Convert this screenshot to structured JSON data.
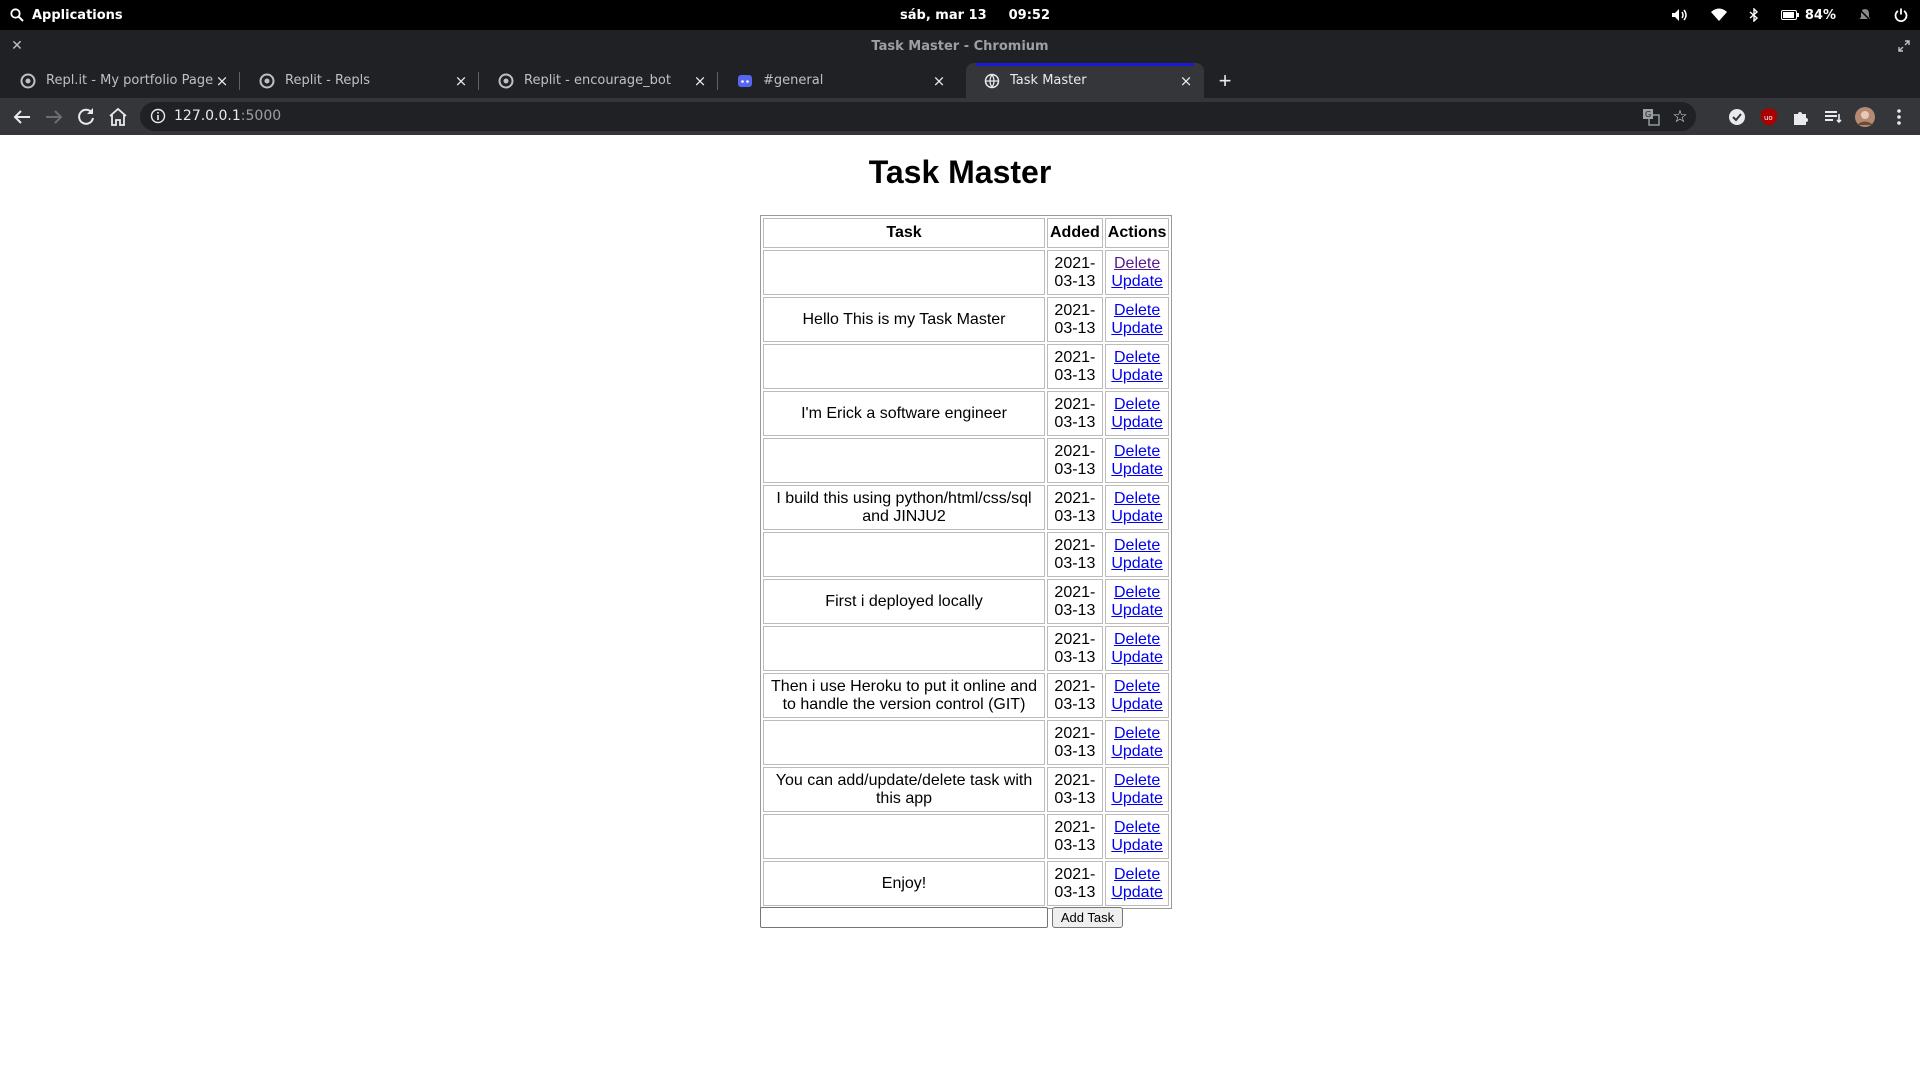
{
  "system_bar": {
    "applications_label": "Applications",
    "date": "sáb, mar 13",
    "time": "09:52",
    "battery_percent": "84%"
  },
  "window": {
    "title": "Task Master - Chromium"
  },
  "tabs": [
    {
      "label": "Repl.it - My portfolio Page",
      "favicon": "replit-icon",
      "active": false
    },
    {
      "label": "Replit - Repls",
      "favicon": "replit-icon",
      "active": false
    },
    {
      "label": "Replit - encourage_bot",
      "favicon": "replit-icon",
      "active": false
    },
    {
      "label": "#general",
      "favicon": "discord-icon",
      "active": false
    },
    {
      "label": "Task Master",
      "favicon": "globe-icon",
      "active": true
    }
  ],
  "address_bar": {
    "host": "127.0.0.1",
    "port": ":5000"
  },
  "page": {
    "heading": "Task Master",
    "columns": [
      "Task",
      "Added",
      "Actions"
    ],
    "delete_label": "Delete",
    "update_label": "Update",
    "rows": [
      {
        "task": "",
        "added_year": "2021-",
        "added_rest": "03-13"
      },
      {
        "task": "Hello This is my Task Master",
        "added_year": "2021-",
        "added_rest": "03-13"
      },
      {
        "task": "",
        "added_year": "2021-",
        "added_rest": "03-13"
      },
      {
        "task": "I'm Erick a software engineer",
        "added_year": "2021-",
        "added_rest": "03-13"
      },
      {
        "task": "",
        "added_year": "2021-",
        "added_rest": "03-13"
      },
      {
        "task": "I build this using python/html/css/sql and JINJU2",
        "added_year": "2021-",
        "added_rest": "03-13"
      },
      {
        "task": "",
        "added_year": "2021-",
        "added_rest": "03-13"
      },
      {
        "task": "First i deployed locally",
        "added_year": "2021-",
        "added_rest": "03-13"
      },
      {
        "task": "",
        "added_year": "2021-",
        "added_rest": "03-13"
      },
      {
        "task": "Then i use Heroku to put it online and to handle the version control (GIT)",
        "added_year": "2021-",
        "added_rest": "03-13"
      },
      {
        "task": "",
        "added_year": "2021-",
        "added_rest": "03-13"
      },
      {
        "task": "You can add/update/delete task with this app",
        "added_year": "2021-",
        "added_rest": "03-13"
      },
      {
        "task": "",
        "added_year": "2021-",
        "added_rest": "03-13"
      },
      {
        "task": "Enjoy!",
        "added_year": "2021-",
        "added_rest": "03-13"
      }
    ],
    "new_task_value": "",
    "add_button_label": "Add Task"
  },
  "colors": {
    "link": "#0000ee",
    "visited_link": "#551a8b",
    "active_tab_indicator": "#1a1ad8"
  }
}
